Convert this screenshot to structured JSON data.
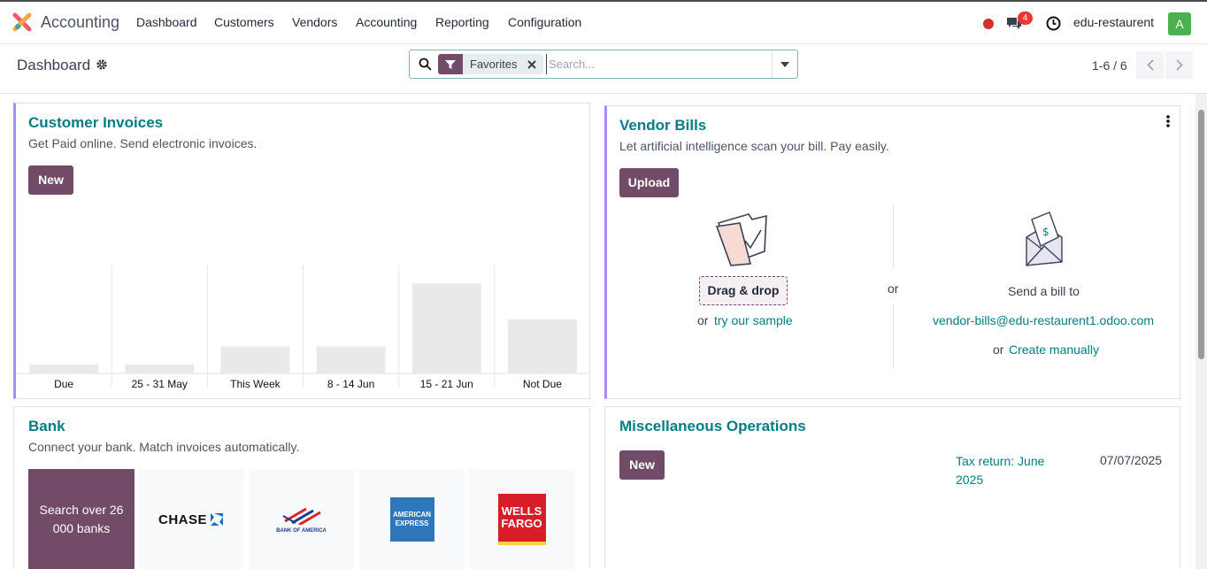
{
  "navbar": {
    "app_name": "Accounting",
    "menus": [
      "Dashboard",
      "Customers",
      "Vendors",
      "Accounting",
      "Reporting",
      "Configuration"
    ],
    "chat_count": "4",
    "company": "edu-restaurent",
    "avatar_letter": "A"
  },
  "control_panel": {
    "breadcrumb": "Dashboard",
    "facet_label": "Favorites",
    "search_placeholder": "Search...",
    "pager": "1-6 / 6"
  },
  "customer_invoices": {
    "title": "Customer Invoices",
    "subtitle": "Get Paid online. Send electronic invoices.",
    "new_label": "New"
  },
  "chart_data": {
    "type": "bar",
    "categories": [
      "Due",
      "25 - 31 May",
      "This Week",
      "8 - 14 Jun",
      "15 - 21 Jun",
      "Not Due"
    ],
    "values": [
      1,
      1,
      3,
      3,
      10,
      6
    ],
    "ylim": [
      0,
      12
    ],
    "grid": true,
    "colors": [
      "#e9e9e9"
    ]
  },
  "vendor_bills": {
    "title": "Vendor Bills",
    "subtitle": "Let artificial intelligence scan your bill. Pay easily.",
    "upload_label": "Upload",
    "drag_drop_label": "Drag & drop",
    "or_label": "or",
    "try_sample_label": "try our sample",
    "send_bill_label": "Send a bill to",
    "email": "vendor-bills@edu-restaurent1.odoo.com",
    "create_manually_label": "Create manually"
  },
  "bank": {
    "title": "Bank",
    "subtitle": "Connect your bank. Match invoices automatically.",
    "search_banks_label": "Search over 26 000 banks",
    "banks": [
      "CHASE",
      "BANK OF AMERICA",
      "AMERICAN EXPRESS",
      "WELLS FARGO"
    ]
  },
  "misc_operations": {
    "title": "Miscellaneous Operations",
    "new_label": "New",
    "activity_name": "Tax return: June 2025",
    "activity_date": "07/07/2025"
  },
  "colors": {
    "brand": "#714b67",
    "link": "#017e84",
    "accent_border": "#a78bfa"
  }
}
